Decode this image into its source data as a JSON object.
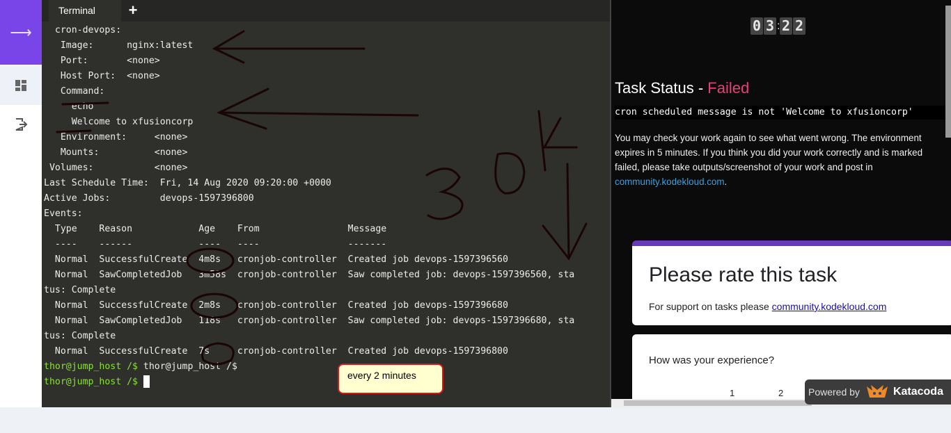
{
  "nav": {
    "icons": [
      "arrow-right-icon",
      "dashboard-icon",
      "logout-icon"
    ]
  },
  "terminal": {
    "tab_label": "Terminal",
    "add_tab_label": "+",
    "lines": [
      "  cron-devops:",
      "   Image:      nginx:latest",
      "   Port:       <none>",
      "   Host Port:  <none>",
      "   Command:",
      "     echo",
      "     Welcome to xfusioncorp",
      "   Environment:     <none>",
      "   Mounts:          <none>",
      " Volumes:           <none>",
      "Last Schedule Time:  Fri, 14 Aug 2020 09:20:00 +0000",
      "Active Jobs:         devops-1597396800",
      "Events:",
      "  Type    Reason            Age    From                Message",
      "  ----    ------            ----   ----                -------",
      "  Normal  SuccessfulCreate  4m8s   cronjob-controller  Created job devops-1597396560",
      "  Normal  SawCompletedJob   3m58s  cronjob-controller  Saw completed job: devops-1597396560, sta",
      "tus: Complete",
      "  Normal  SuccessfulCreate  2m8s   cronjob-controller  Created job devops-1597396680",
      "  Normal  SawCompletedJob   118s   cronjob-controller  Saw completed job: devops-1597396680, sta",
      "tus: Complete",
      "  Normal  SuccessfulCreate  7s     cronjob-controller  Created job devops-1597396800"
    ],
    "prompt_line_1": {
      "prompt": "thor@jump_host /$",
      "rest": " thor@jump_host /$"
    },
    "prompt_line_2": {
      "prompt": "thor@jump_host /$",
      "rest": " "
    },
    "annotation_text": "30 K",
    "callout": "every 2 minutes"
  },
  "task": {
    "timer_digits": [
      "0",
      "3",
      "2",
      "2"
    ],
    "timer_separator": ":",
    "title_prefix": "Task Status - ",
    "status": "Failed",
    "status_color": "#ea3e74",
    "failure_message": "cron scheduled message is not 'Welcome to xfusioncorp'",
    "description": "You may check your work again to see what went wrong. The environment expires in 5 minutes. If you think you did your work correctly and is marked failed, please take outputs/screenshot of your work and post in ",
    "description_link": "community.kodekloud.com",
    "description_end": "."
  },
  "rating": {
    "title": "Please rate this task",
    "support_text": "For support on tasks please ",
    "support_link": "community.kodekloud.com",
    "question": "How was your experience?",
    "scale": [
      "1",
      "2"
    ]
  },
  "powered": {
    "label": "Powered by",
    "brand": "Katacoda"
  }
}
